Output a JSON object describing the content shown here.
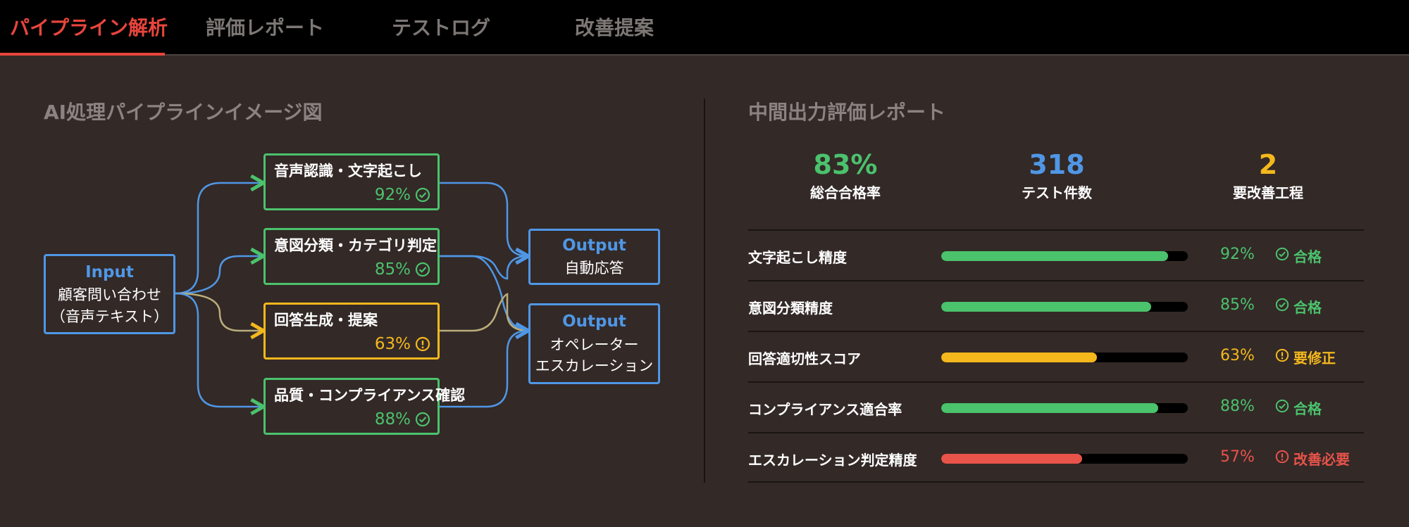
{
  "tabs": [
    {
      "label": "パイプライン解析",
      "active": true
    },
    {
      "label": "評価レポート",
      "active": false
    },
    {
      "label": "テストログ",
      "active": false
    },
    {
      "label": "改善提案",
      "active": false
    }
  ],
  "pipeline": {
    "title": "AI処理パイプラインイメージ図",
    "input": {
      "head": "Input",
      "line1": "顧客問い合わせ",
      "line2": "（音声テキスト）"
    },
    "stages": [
      {
        "title": "音声認識・文字起こし",
        "score": "92%",
        "status": "ok"
      },
      {
        "title": "意図分類・カテゴリ判定",
        "score": "85%",
        "status": "ok"
      },
      {
        "title": "回答生成・提案",
        "score": "63%",
        "status": "warn"
      },
      {
        "title": "品質・コンプライアンス確認",
        "score": "88%",
        "status": "ok"
      }
    ],
    "outputs": [
      {
        "head": "Output",
        "line1": "自動応答",
        "line2": ""
      },
      {
        "head": "Output",
        "line1": "オペレーター",
        "line2": "エスカレーション"
      }
    ]
  },
  "report": {
    "title": "中間出力評価レポート",
    "stats": [
      {
        "value": "83%",
        "label": "総合合格率",
        "color": "#4bc26c"
      },
      {
        "value": "318",
        "label": "テスト件数",
        "color": "#4f97e6"
      },
      {
        "value": "2",
        "label": "要改善工程",
        "color": "#f4b81d"
      }
    ],
    "rows": [
      {
        "label": "文字起こし精度",
        "percent": 92,
        "pct_text": "92%",
        "status_text": "合格",
        "status": "ok",
        "color": "#4bc26c"
      },
      {
        "label": "意図分類精度",
        "percent": 85,
        "pct_text": "85%",
        "status_text": "合格",
        "status": "ok",
        "color": "#4bc26c"
      },
      {
        "label": "回答適切性スコア",
        "percent": 63,
        "pct_text": "63%",
        "status_text": "要修正",
        "status": "warn",
        "color": "#f4b81d"
      },
      {
        "label": "コンプライアンス適合率",
        "percent": 88,
        "pct_text": "88%",
        "status_text": "合格",
        "status": "ok",
        "color": "#4bc26c"
      },
      {
        "label": "エスカレーション判定精度",
        "percent": 57,
        "pct_text": "57%",
        "status_text": "改善必要",
        "status": "bad",
        "color": "#e8534a"
      }
    ]
  },
  "colors": {
    "accent_red": "#e8453c",
    "green": "#4bc26c",
    "blue": "#4f97e6",
    "yellow": "#f4b81d",
    "red": "#e8534a"
  }
}
